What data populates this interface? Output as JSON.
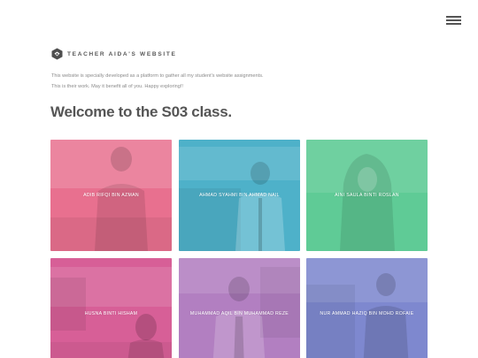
{
  "site": {
    "logo_text": "TEACHER AIDA'S WEBSITE",
    "intro_line1": "This website is specially developed as a platform to gather all my student's website assignments.",
    "intro_line2": "This is their work. May it benefit all of you. Happy exploring!!",
    "title": "Welcome to the S03 class.",
    "menu_icon": "hamburger-menu-icon"
  },
  "students": [
    {
      "name": "ADIB RIFQI BIN AZMAN",
      "color": "#e8708f"
    },
    {
      "name": "AHMAD SYAHMI BIN AHMAD NAIL",
      "color": "#4eb1c9"
    },
    {
      "name": "AINI SAULA BINTI ROSLAN",
      "color": "#5fcb96"
    },
    {
      "name": "HUSNA BINTI HISHAM",
      "color": "#d75f97"
    },
    {
      "name": "MUHAMMAD AQIL BIN MUHAMMAD REZE",
      "color": "#b27fc1"
    },
    {
      "name": "NUR AMMAD HAZIQ BIN MOHD ROFAIE",
      "color": "#7e88cf"
    }
  ]
}
